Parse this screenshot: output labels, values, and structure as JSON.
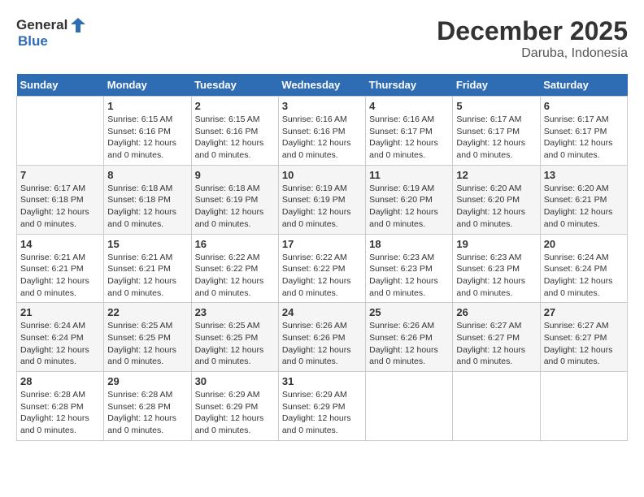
{
  "logo": {
    "text_general": "General",
    "text_blue": "Blue"
  },
  "title": "December 2025",
  "subtitle": "Daruba, Indonesia",
  "days_of_week": [
    "Sunday",
    "Monday",
    "Tuesday",
    "Wednesday",
    "Thursday",
    "Friday",
    "Saturday"
  ],
  "weeks": [
    [
      {
        "day": "",
        "sunrise": "",
        "sunset": "",
        "daylight": ""
      },
      {
        "day": "1",
        "sunrise": "Sunrise: 6:15 AM",
        "sunset": "Sunset: 6:16 PM",
        "daylight": "Daylight: 12 hours and 0 minutes."
      },
      {
        "day": "2",
        "sunrise": "Sunrise: 6:15 AM",
        "sunset": "Sunset: 6:16 PM",
        "daylight": "Daylight: 12 hours and 0 minutes."
      },
      {
        "day": "3",
        "sunrise": "Sunrise: 6:16 AM",
        "sunset": "Sunset: 6:16 PM",
        "daylight": "Daylight: 12 hours and 0 minutes."
      },
      {
        "day": "4",
        "sunrise": "Sunrise: 6:16 AM",
        "sunset": "Sunset: 6:17 PM",
        "daylight": "Daylight: 12 hours and 0 minutes."
      },
      {
        "day": "5",
        "sunrise": "Sunrise: 6:17 AM",
        "sunset": "Sunset: 6:17 PM",
        "daylight": "Daylight: 12 hours and 0 minutes."
      },
      {
        "day": "6",
        "sunrise": "Sunrise: 6:17 AM",
        "sunset": "Sunset: 6:17 PM",
        "daylight": "Daylight: 12 hours and 0 minutes."
      }
    ],
    [
      {
        "day": "7",
        "sunrise": "Sunrise: 6:17 AM",
        "sunset": "Sunset: 6:18 PM",
        "daylight": "Daylight: 12 hours and 0 minutes."
      },
      {
        "day": "8",
        "sunrise": "Sunrise: 6:18 AM",
        "sunset": "Sunset: 6:18 PM",
        "daylight": "Daylight: 12 hours and 0 minutes."
      },
      {
        "day": "9",
        "sunrise": "Sunrise: 6:18 AM",
        "sunset": "Sunset: 6:19 PM",
        "daylight": "Daylight: 12 hours and 0 minutes."
      },
      {
        "day": "10",
        "sunrise": "Sunrise: 6:19 AM",
        "sunset": "Sunset: 6:19 PM",
        "daylight": "Daylight: 12 hours and 0 minutes."
      },
      {
        "day": "11",
        "sunrise": "Sunrise: 6:19 AM",
        "sunset": "Sunset: 6:20 PM",
        "daylight": "Daylight: 12 hours and 0 minutes."
      },
      {
        "day": "12",
        "sunrise": "Sunrise: 6:20 AM",
        "sunset": "Sunset: 6:20 PM",
        "daylight": "Daylight: 12 hours and 0 minutes."
      },
      {
        "day": "13",
        "sunrise": "Sunrise: 6:20 AM",
        "sunset": "Sunset: 6:21 PM",
        "daylight": "Daylight: 12 hours and 0 minutes."
      }
    ],
    [
      {
        "day": "14",
        "sunrise": "Sunrise: 6:21 AM",
        "sunset": "Sunset: 6:21 PM",
        "daylight": "Daylight: 12 hours and 0 minutes."
      },
      {
        "day": "15",
        "sunrise": "Sunrise: 6:21 AM",
        "sunset": "Sunset: 6:21 PM",
        "daylight": "Daylight: 12 hours and 0 minutes."
      },
      {
        "day": "16",
        "sunrise": "Sunrise: 6:22 AM",
        "sunset": "Sunset: 6:22 PM",
        "daylight": "Daylight: 12 hours and 0 minutes."
      },
      {
        "day": "17",
        "sunrise": "Sunrise: 6:22 AM",
        "sunset": "Sunset: 6:22 PM",
        "daylight": "Daylight: 12 hours and 0 minutes."
      },
      {
        "day": "18",
        "sunrise": "Sunrise: 6:23 AM",
        "sunset": "Sunset: 6:23 PM",
        "daylight": "Daylight: 12 hours and 0 minutes."
      },
      {
        "day": "19",
        "sunrise": "Sunrise: 6:23 AM",
        "sunset": "Sunset: 6:23 PM",
        "daylight": "Daylight: 12 hours and 0 minutes."
      },
      {
        "day": "20",
        "sunrise": "Sunrise: 6:24 AM",
        "sunset": "Sunset: 6:24 PM",
        "daylight": "Daylight: 12 hours and 0 minutes."
      }
    ],
    [
      {
        "day": "21",
        "sunrise": "Sunrise: 6:24 AM",
        "sunset": "Sunset: 6:24 PM",
        "daylight": "Daylight: 12 hours and 0 minutes."
      },
      {
        "day": "22",
        "sunrise": "Sunrise: 6:25 AM",
        "sunset": "Sunset: 6:25 PM",
        "daylight": "Daylight: 12 hours and 0 minutes."
      },
      {
        "day": "23",
        "sunrise": "Sunrise: 6:25 AM",
        "sunset": "Sunset: 6:25 PM",
        "daylight": "Daylight: 12 hours and 0 minutes."
      },
      {
        "day": "24",
        "sunrise": "Sunrise: 6:26 AM",
        "sunset": "Sunset: 6:26 PM",
        "daylight": "Daylight: 12 hours and 0 minutes."
      },
      {
        "day": "25",
        "sunrise": "Sunrise: 6:26 AM",
        "sunset": "Sunset: 6:26 PM",
        "daylight": "Daylight: 12 hours and 0 minutes."
      },
      {
        "day": "26",
        "sunrise": "Sunrise: 6:27 AM",
        "sunset": "Sunset: 6:27 PM",
        "daylight": "Daylight: 12 hours and 0 minutes."
      },
      {
        "day": "27",
        "sunrise": "Sunrise: 6:27 AM",
        "sunset": "Sunset: 6:27 PM",
        "daylight": "Daylight: 12 hours and 0 minutes."
      }
    ],
    [
      {
        "day": "28",
        "sunrise": "Sunrise: 6:28 AM",
        "sunset": "Sunset: 6:28 PM",
        "daylight": "Daylight: 12 hours and 0 minutes."
      },
      {
        "day": "29",
        "sunrise": "Sunrise: 6:28 AM",
        "sunset": "Sunset: 6:28 PM",
        "daylight": "Daylight: 12 hours and 0 minutes."
      },
      {
        "day": "30",
        "sunrise": "Sunrise: 6:29 AM",
        "sunset": "Sunset: 6:29 PM",
        "daylight": "Daylight: 12 hours and 0 minutes."
      },
      {
        "day": "31",
        "sunrise": "Sunrise: 6:29 AM",
        "sunset": "Sunset: 6:29 PM",
        "daylight": "Daylight: 12 hours and 0 minutes."
      },
      {
        "day": "",
        "sunrise": "",
        "sunset": "",
        "daylight": ""
      },
      {
        "day": "",
        "sunrise": "",
        "sunset": "",
        "daylight": ""
      },
      {
        "day": "",
        "sunrise": "",
        "sunset": "",
        "daylight": ""
      }
    ]
  ]
}
